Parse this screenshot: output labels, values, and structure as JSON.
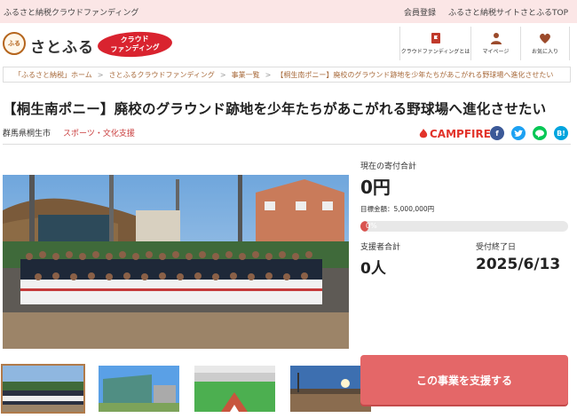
{
  "topbar": {
    "site_label": "ふるさと納税クラウドファンディング",
    "member_link": "会員登録",
    "top_link": "ふるさと納税サイトさとふるTOP"
  },
  "header": {
    "logo_text": "さとふる",
    "badge_line1": "クラウド",
    "badge_line2": "ファンディング",
    "nav": [
      {
        "label": "クラウドファンディングとは",
        "icon": "flag-icon"
      },
      {
        "label": "マイページ",
        "icon": "user-icon"
      },
      {
        "label": "お気に入り",
        "icon": "heart-icon"
      }
    ]
  },
  "breadcrumb": [
    "「ふるさと納税」ホーム",
    "さとふるクラウドファンディング",
    "事業一覧",
    "【桐生南ポニー】廃校のグラウンド跡地を少年たちがあこがれる野球場へ進化させたい"
  ],
  "project": {
    "title": "【桐生南ポニー】廃校のグラウンド跡地を少年たちがあこがれる野球場へ進化させたい",
    "location": "群馬県桐生市",
    "category": "スポーツ・文化支援",
    "partner": "CAMPFIRE"
  },
  "shares": [
    {
      "icon": "facebook-icon",
      "glyph": "f",
      "color": "#3b5998"
    },
    {
      "icon": "twitter-icon",
      "glyph": "t",
      "color": "#1da1f2"
    },
    {
      "icon": "line-icon",
      "glyph": "L",
      "color": "#06c755"
    },
    {
      "icon": "hatena-icon",
      "glyph": "B!",
      "color": "#00a4de"
    }
  ],
  "stats": {
    "current_label": "現在の寄付合計",
    "current_value": "0円",
    "goal_text": "目標金額：5,000,000円",
    "progress_text": "0%",
    "progress_fraction": 0.0,
    "supporters_label": "支援者合計",
    "supporters_value": "0人",
    "deadline_label": "受付終了日",
    "deadline_value": "2025/6/13"
  },
  "cta": {
    "label": "この事業を支援する"
  },
  "colors": {
    "accent": "#d9534f",
    "cta": "#e46768",
    "category": "#c93d3d",
    "brand_red": "#d9232f"
  }
}
